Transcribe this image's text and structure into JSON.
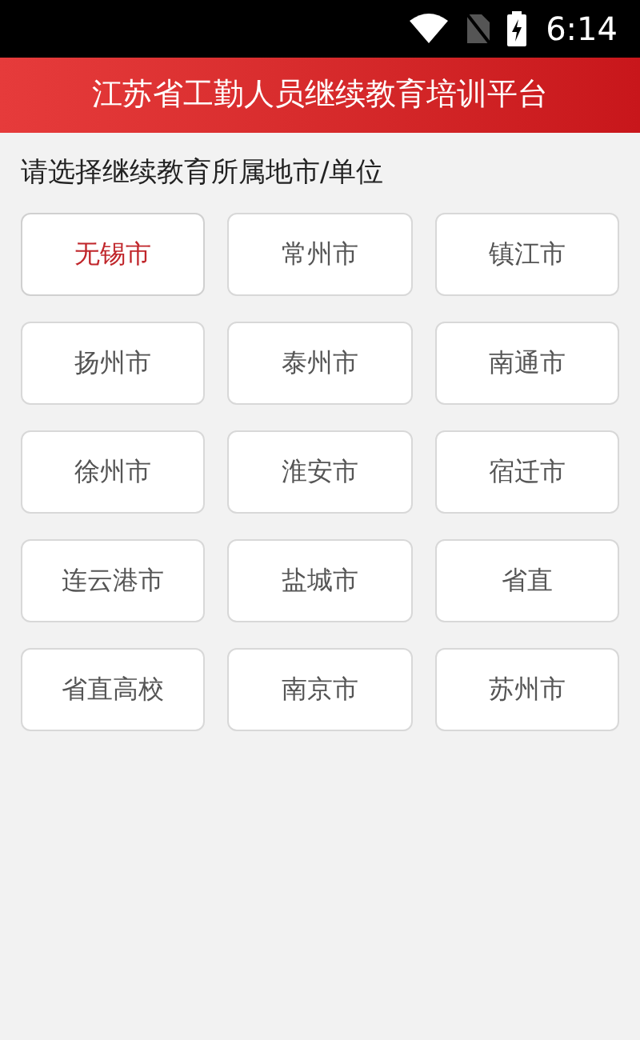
{
  "status_bar": {
    "time": "6:14"
  },
  "header": {
    "title": "江苏省工勤人员继续教育培训平台"
  },
  "prompt": "请选择继续教育所属地市/单位",
  "options": [
    {
      "label": "无锡市",
      "selected": true
    },
    {
      "label": "常州市",
      "selected": false
    },
    {
      "label": "镇江市",
      "selected": false
    },
    {
      "label": "扬州市",
      "selected": false
    },
    {
      "label": "泰州市",
      "selected": false
    },
    {
      "label": "南通市",
      "selected": false
    },
    {
      "label": "徐州市",
      "selected": false
    },
    {
      "label": "淮安市",
      "selected": false
    },
    {
      "label": "宿迁市",
      "selected": false
    },
    {
      "label": "连云港市",
      "selected": false
    },
    {
      "label": "盐城市",
      "selected": false
    },
    {
      "label": "省直",
      "selected": false
    },
    {
      "label": "省直高校",
      "selected": false
    },
    {
      "label": "南京市",
      "selected": false
    },
    {
      "label": "苏州市",
      "selected": false
    }
  ]
}
